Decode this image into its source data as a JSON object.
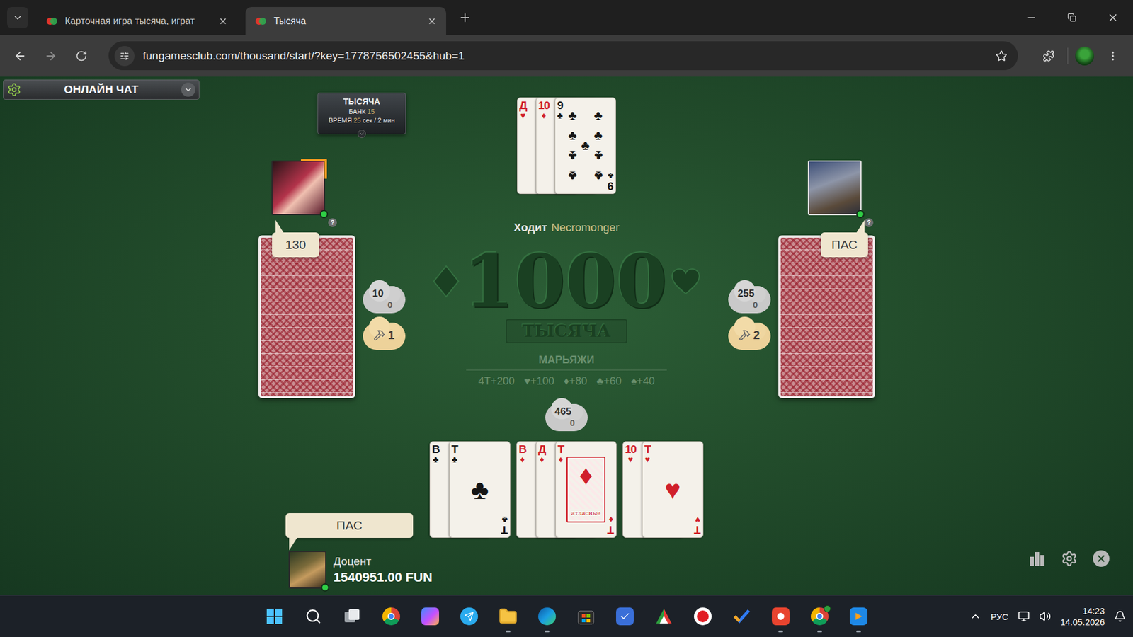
{
  "browser": {
    "tabs": [
      {
        "title": "Карточная игра тысяча, играт",
        "selected": false
      },
      {
        "title": "Тысяча",
        "selected": true
      }
    ],
    "url": "fungamesclub.com/thousand/start/?key=1778756502455&hub=1",
    "bookmarked": false
  },
  "game": {
    "chat": {
      "label": "ОНЛАЙН ЧАТ",
      "expanded": false
    },
    "info": {
      "title": "ТЫСЯЧА",
      "bank_label": "БАНК",
      "bank": "15",
      "time_label": "ВРЕМЯ",
      "time": "25",
      "time_rest": "сек / 2 мин"
    },
    "talon": [
      {
        "rank": "Д",
        "suit": "♥"
      },
      {
        "rank": "10",
        "suit": "♦"
      },
      {
        "rank": "9",
        "suit": "♣"
      }
    ],
    "turn": {
      "label": "Ходит",
      "player": "Necromonger"
    },
    "logo": {
      "number": "1000",
      "ribbon": "ТЫСЯЧА"
    },
    "marriages": {
      "title": "МАРЬЯЖИ",
      "items": [
        "4Т+200",
        "♥+100",
        "♦+80",
        "♣+60",
        "♠+40"
      ]
    },
    "opponents": [
      {
        "seat": "left",
        "bid": "130",
        "score": "10",
        "penalty": "0",
        "bolts": "1",
        "active": true,
        "badge": "?"
      },
      {
        "seat": "right",
        "bid": "ПАС",
        "score": "255",
        "penalty": "0",
        "bolts": "2",
        "active": false,
        "badge": "?"
      }
    ],
    "me": {
      "bid": "ПАС",
      "score": "465",
      "penalty": "0",
      "name": "Доцент",
      "balance": "1540951.00 FUN"
    },
    "hand": [
      {
        "cards": [
          {
            "rank": "В",
            "suit": "♣"
          },
          {
            "rank": "Т",
            "suit": "♣"
          }
        ]
      },
      {
        "cards": [
          {
            "rank": "В",
            "suit": "♦"
          },
          {
            "rank": "Д",
            "suit": "♦"
          },
          {
            "rank": "Т",
            "suit": "♦",
            "label": "атласные"
          }
        ]
      },
      {
        "cards": [
          {
            "rank": "10",
            "suit": "♥"
          },
          {
            "rank": "Т",
            "suit": "♥"
          }
        ]
      }
    ]
  },
  "taskbar": {
    "apps": [
      {
        "running": false
      },
      {
        "running": false
      },
      {
        "running": false
      },
      {
        "running": false
      },
      {
        "running": false
      },
      {
        "running": false
      },
      {
        "running": true
      },
      {
        "running": true
      },
      {
        "running": false
      },
      {
        "running": false
      },
      {
        "running": false
      },
      {
        "running": false
      },
      {
        "running": false
      },
      {
        "running": true
      },
      {
        "running": true
      },
      {
        "running": true
      }
    ],
    "tray": {
      "lang": "РУС",
      "time": "14:23",
      "date": "14.05.2026"
    }
  }
}
